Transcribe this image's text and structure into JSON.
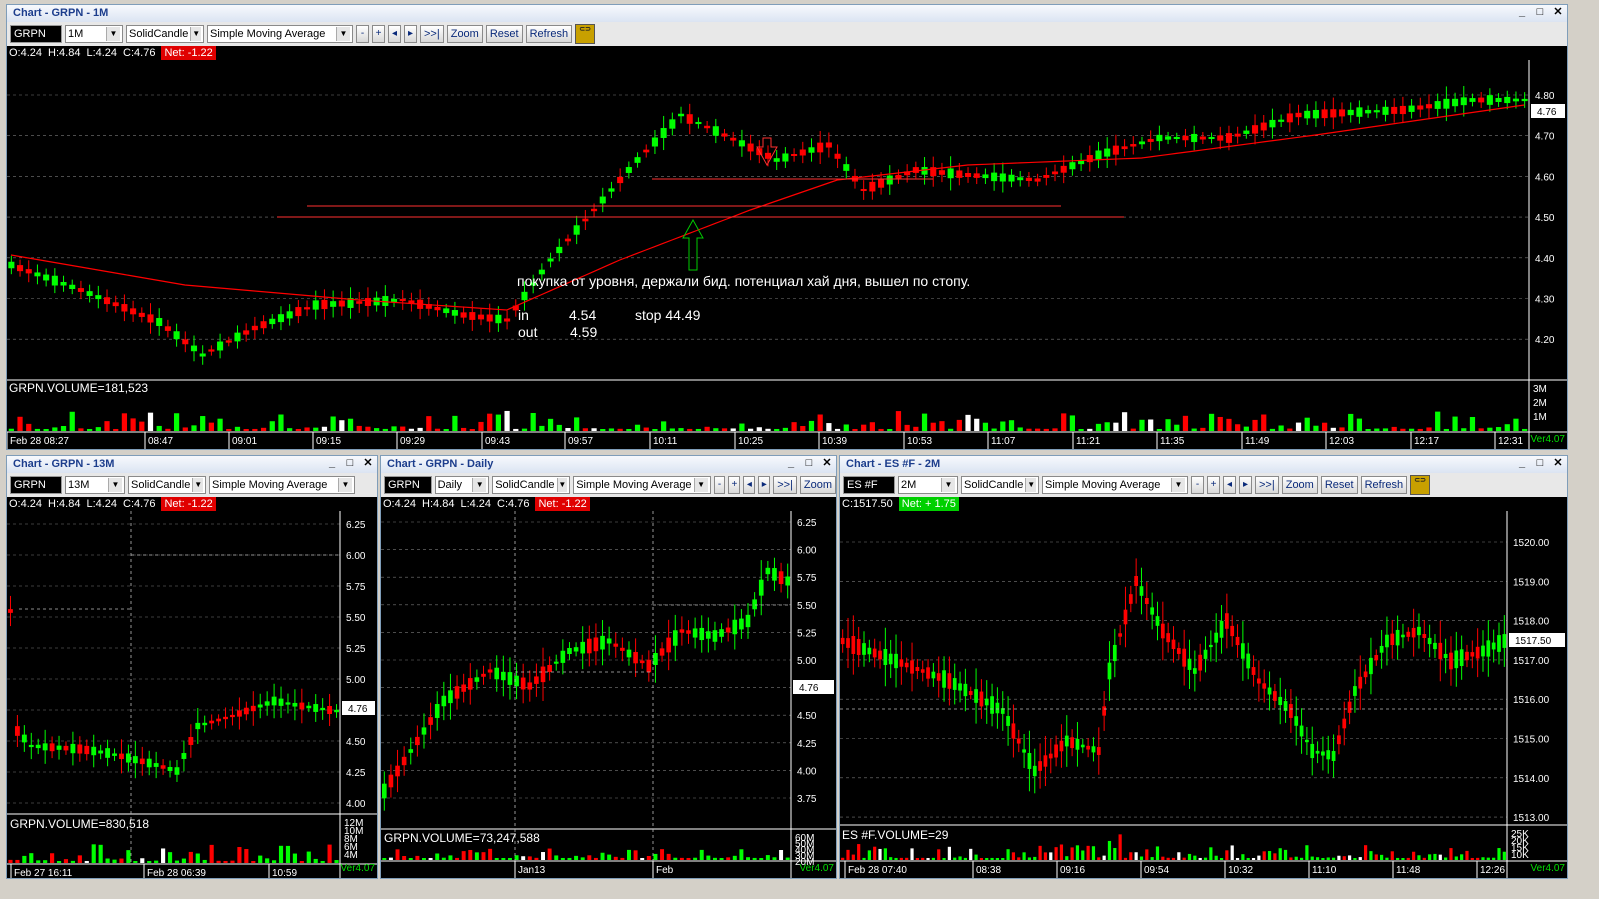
{
  "colors": {
    "up": "#00ff00",
    "down": "#ff0000",
    "ma": "#ff0000",
    "bg": "#000000",
    "grid": "#7a7a7a",
    "title": "#1c3d8c"
  },
  "windows": {
    "main": {
      "title": "Chart - GRPN - 1M",
      "symbol": "GRPN",
      "interval": "1M",
      "candle": "SolidCandle",
      "indicator": "Simple Moving Average",
      "buttons": {
        "minus": "-",
        "plus": "+",
        "prev": "◂",
        "next": "▸",
        "end": ">>|",
        "zoom": "Zoom",
        "reset": "Reset",
        "refresh": "Refresh"
      },
      "ohlc": {
        "o": "O:4.24",
        "h": "H:4.84",
        "l": "L:4.24",
        "c": "C:4.76",
        "net": "Net: -1.22"
      },
      "price_labels": [
        "4.80",
        "4.70",
        "4.60",
        "4.50",
        "4.40",
        "4.30",
        "4.20"
      ],
      "last_price": "4.76",
      "volume_label": "GRPN.VOLUME=181,523",
      "volume_ticks": [
        "3M",
        "2M",
        "1M"
      ],
      "time_labels": [
        "Feb 28 08:27",
        "08:47",
        "09:01",
        "09:15",
        "09:29",
        "09:43",
        "09:57",
        "10:11",
        "10:25",
        "10:39",
        "10:53",
        "11:07",
        "11:21",
        "11:35",
        "11:49",
        "12:03",
        "12:17",
        "12:31"
      ],
      "version": "Ver4.07",
      "annotation": {
        "text": "покупка от уровня, держали бид. потенциал хай дня, вышел по стопу.",
        "in_label": "in",
        "in_value": "4.54",
        "stop": "stop 44.49",
        "out_label": "out",
        "out_value": "4.59"
      }
    },
    "w13": {
      "title": "Chart - GRPN - 13M",
      "symbol": "GRPN",
      "interval": "13M",
      "candle": "SolidCandle",
      "indicator": "Simple Moving Average",
      "ohlc": {
        "o": "O:4.24",
        "h": "H:4.84",
        "l": "L:4.24",
        "c": "C:4.76",
        "net": "Net: -1.22"
      },
      "price_labels": [
        "6.25",
        "6.00",
        "5.75",
        "5.50",
        "5.25",
        "5.00",
        "4.75",
        "4.50",
        "4.25",
        "4.00"
      ],
      "last_price": "4.76",
      "volume_label": "GRPN.VOLUME=830,518",
      "volume_ticks": [
        "12M",
        "10M",
        "8M",
        "6M",
        "4M"
      ],
      "time_labels": [
        "Feb 27 16:11",
        "Feb 28 06:39",
        "10:59"
      ],
      "version": "Ver4.07"
    },
    "daily": {
      "title": "Chart - GRPN - Daily",
      "symbol": "GRPN",
      "interval": "Daily",
      "candle": "SolidCandle",
      "indicator": "Simple Moving Average",
      "buttons": {
        "minus": "-",
        "plus": "+",
        "prev": "◂",
        "next": "▸",
        "end": ">>|",
        "zoom": "Zoom"
      },
      "ohlc": {
        "o": "O:4.24",
        "h": "H:4.84",
        "l": "L:4.24",
        "c": "C:4.76",
        "net": "Net: -1.22"
      },
      "price_labels": [
        "6.25",
        "6.00",
        "5.75",
        "5.50",
        "5.25",
        "5.00",
        "4.75",
        "4.50",
        "4.25",
        "4.00",
        "3.75"
      ],
      "last_price": "4.76",
      "volume_label": "GRPN.VOLUME=73,247,588",
      "volume_ticks": [
        "60M",
        "50M",
        "40M",
        "30M",
        "20M"
      ],
      "time_labels": [
        "Jan13",
        "Feb"
      ],
      "version": "Ver4.07"
    },
    "es": {
      "title": "Chart - ES #F - 2M",
      "symbol": "ES #F",
      "interval": "2M",
      "candle": "SolidCandle",
      "indicator": "Simple Moving Average",
      "buttons": {
        "minus": "-",
        "plus": "+",
        "prev": "◂",
        "next": "▸",
        "end": ">>|",
        "zoom": "Zoom",
        "reset": "Reset",
        "refresh": "Refresh"
      },
      "ohlc": {
        "c": "C:1517.50",
        "net": "Net: + 1.75"
      },
      "price_labels": [
        "1520.00",
        "1519.00",
        "1518.00",
        "1517.00",
        "1516.00",
        "1515.00",
        "1514.00",
        "1513.00"
      ],
      "last_price": "1517.50",
      "volume_label": "ES #F.VOLUME=29",
      "volume_ticks": [
        "25K",
        "20K",
        "15K",
        "10K"
      ],
      "time_labels": [
        "Feb 28 07:40",
        "08:38",
        "09:16",
        "09:54",
        "10:32",
        "11:10",
        "11:48",
        "12:26"
      ],
      "version": "Ver4.07"
    }
  }
}
